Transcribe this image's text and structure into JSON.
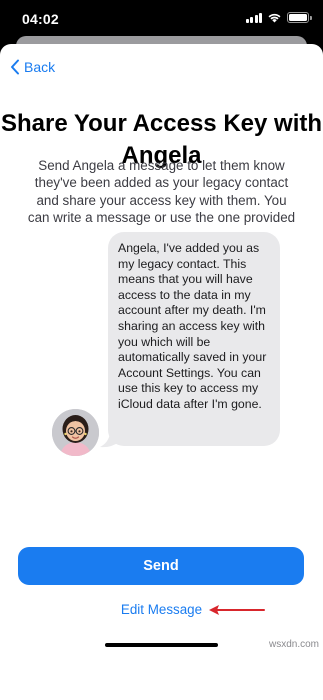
{
  "status_bar": {
    "time": "04:02",
    "icons": [
      "cellular-signal-icon",
      "wifi-icon",
      "battery-icon"
    ]
  },
  "nav": {
    "back_label": "Back"
  },
  "title": "Share Your Access Key with Angela",
  "description": "Send Angela a message to let them know they've been added as your legacy contact and share your access key with them. You can write a message or use the one provided",
  "message": {
    "text": "Angela, I've added you as my legacy contact. This means that you will have access to the data in my account after my death. I'm sharing an access key with you which will be automatically saved in your Account Settings. You can use this key to access my iCloud data after I'm gone.",
    "avatar_icon": "memoji-avatar-icon"
  },
  "actions": {
    "send_label": "Send",
    "edit_label": "Edit Message"
  },
  "watermark": "wsxdn.com",
  "colors": {
    "accent": "#1a7cf0",
    "bubble": "#e9e9eb",
    "arrow": "#d8262c"
  }
}
